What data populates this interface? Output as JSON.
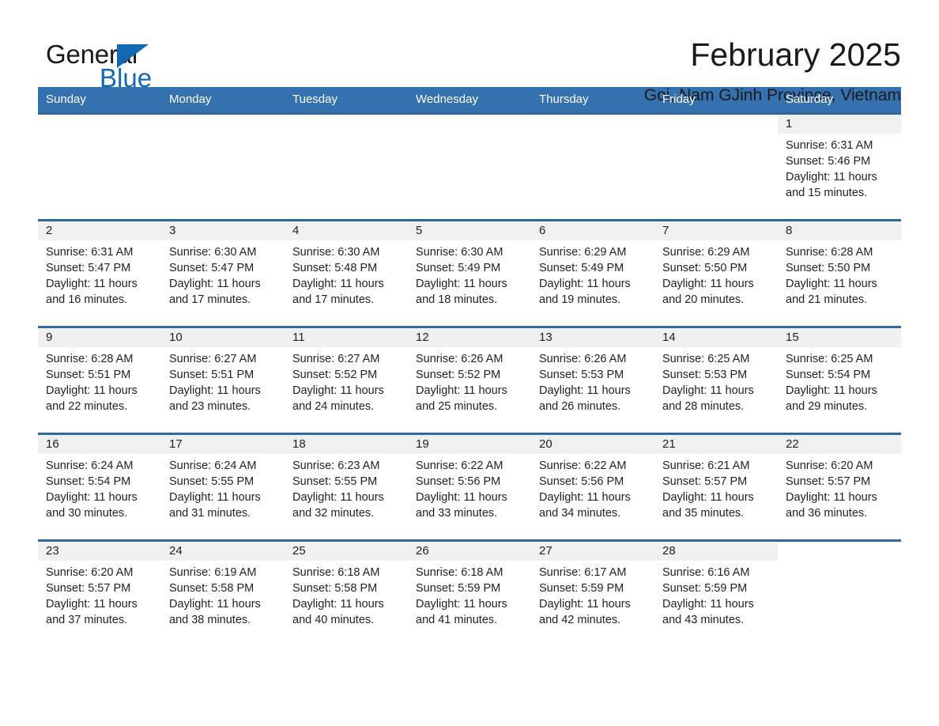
{
  "brand": {
    "name_part1": "General",
    "name_part2": "Blue",
    "logo_icon": "triangle-logo-icon"
  },
  "header": {
    "title": "February 2025",
    "subtitle": "Goi, Nam GJinh Province, Vietnam"
  },
  "colors": {
    "header_blue": "#3471ae",
    "rule_blue": "#31699c",
    "brand_blue": "#1268b3",
    "daynum_band": "#f0f0f0",
    "text": "#222222"
  },
  "weekday_headers": [
    "Sunday",
    "Monday",
    "Tuesday",
    "Wednesday",
    "Thursday",
    "Friday",
    "Saturday"
  ],
  "labels": {
    "sunrise_prefix": "Sunrise: ",
    "sunset_prefix": "Sunset: ",
    "daylight_prefix": "Daylight: "
  },
  "weeks": [
    [
      {
        "day": "",
        "blank": true
      },
      {
        "day": "",
        "blank": true
      },
      {
        "day": "",
        "blank": true
      },
      {
        "day": "",
        "blank": true
      },
      {
        "day": "",
        "blank": true
      },
      {
        "day": "",
        "blank": true
      },
      {
        "day": "1",
        "sunrise": "Sunrise: 6:31 AM",
        "sunset": "Sunset: 5:46 PM",
        "daylight": "Daylight: 11 hours and 15 minutes."
      }
    ],
    [
      {
        "day": "2",
        "sunrise": "Sunrise: 6:31 AM",
        "sunset": "Sunset: 5:47 PM",
        "daylight": "Daylight: 11 hours and 16 minutes."
      },
      {
        "day": "3",
        "sunrise": "Sunrise: 6:30 AM",
        "sunset": "Sunset: 5:47 PM",
        "daylight": "Daylight: 11 hours and 17 minutes."
      },
      {
        "day": "4",
        "sunrise": "Sunrise: 6:30 AM",
        "sunset": "Sunset: 5:48 PM",
        "daylight": "Daylight: 11 hours and 17 minutes."
      },
      {
        "day": "5",
        "sunrise": "Sunrise: 6:30 AM",
        "sunset": "Sunset: 5:49 PM",
        "daylight": "Daylight: 11 hours and 18 minutes."
      },
      {
        "day": "6",
        "sunrise": "Sunrise: 6:29 AM",
        "sunset": "Sunset: 5:49 PM",
        "daylight": "Daylight: 11 hours and 19 minutes."
      },
      {
        "day": "7",
        "sunrise": "Sunrise: 6:29 AM",
        "sunset": "Sunset: 5:50 PM",
        "daylight": "Daylight: 11 hours and 20 minutes."
      },
      {
        "day": "8",
        "sunrise": "Sunrise: 6:28 AM",
        "sunset": "Sunset: 5:50 PM",
        "daylight": "Daylight: 11 hours and 21 minutes."
      }
    ],
    [
      {
        "day": "9",
        "sunrise": "Sunrise: 6:28 AM",
        "sunset": "Sunset: 5:51 PM",
        "daylight": "Daylight: 11 hours and 22 minutes."
      },
      {
        "day": "10",
        "sunrise": "Sunrise: 6:27 AM",
        "sunset": "Sunset: 5:51 PM",
        "daylight": "Daylight: 11 hours and 23 minutes."
      },
      {
        "day": "11",
        "sunrise": "Sunrise: 6:27 AM",
        "sunset": "Sunset: 5:52 PM",
        "daylight": "Daylight: 11 hours and 24 minutes."
      },
      {
        "day": "12",
        "sunrise": "Sunrise: 6:26 AM",
        "sunset": "Sunset: 5:52 PM",
        "daylight": "Daylight: 11 hours and 25 minutes."
      },
      {
        "day": "13",
        "sunrise": "Sunrise: 6:26 AM",
        "sunset": "Sunset: 5:53 PM",
        "daylight": "Daylight: 11 hours and 26 minutes."
      },
      {
        "day": "14",
        "sunrise": "Sunrise: 6:25 AM",
        "sunset": "Sunset: 5:53 PM",
        "daylight": "Daylight: 11 hours and 28 minutes."
      },
      {
        "day": "15",
        "sunrise": "Sunrise: 6:25 AM",
        "sunset": "Sunset: 5:54 PM",
        "daylight": "Daylight: 11 hours and 29 minutes."
      }
    ],
    [
      {
        "day": "16",
        "sunrise": "Sunrise: 6:24 AM",
        "sunset": "Sunset: 5:54 PM",
        "daylight": "Daylight: 11 hours and 30 minutes."
      },
      {
        "day": "17",
        "sunrise": "Sunrise: 6:24 AM",
        "sunset": "Sunset: 5:55 PM",
        "daylight": "Daylight: 11 hours and 31 minutes."
      },
      {
        "day": "18",
        "sunrise": "Sunrise: 6:23 AM",
        "sunset": "Sunset: 5:55 PM",
        "daylight": "Daylight: 11 hours and 32 minutes."
      },
      {
        "day": "19",
        "sunrise": "Sunrise: 6:22 AM",
        "sunset": "Sunset: 5:56 PM",
        "daylight": "Daylight: 11 hours and 33 minutes."
      },
      {
        "day": "20",
        "sunrise": "Sunrise: 6:22 AM",
        "sunset": "Sunset: 5:56 PM",
        "daylight": "Daylight: 11 hours and 34 minutes."
      },
      {
        "day": "21",
        "sunrise": "Sunrise: 6:21 AM",
        "sunset": "Sunset: 5:57 PM",
        "daylight": "Daylight: 11 hours and 35 minutes."
      },
      {
        "day": "22",
        "sunrise": "Sunrise: 6:20 AM",
        "sunset": "Sunset: 5:57 PM",
        "daylight": "Daylight: 11 hours and 36 minutes."
      }
    ],
    [
      {
        "day": "23",
        "sunrise": "Sunrise: 6:20 AM",
        "sunset": "Sunset: 5:57 PM",
        "daylight": "Daylight: 11 hours and 37 minutes."
      },
      {
        "day": "24",
        "sunrise": "Sunrise: 6:19 AM",
        "sunset": "Sunset: 5:58 PM",
        "daylight": "Daylight: 11 hours and 38 minutes."
      },
      {
        "day": "25",
        "sunrise": "Sunrise: 6:18 AM",
        "sunset": "Sunset: 5:58 PM",
        "daylight": "Daylight: 11 hours and 40 minutes."
      },
      {
        "day": "26",
        "sunrise": "Sunrise: 6:18 AM",
        "sunset": "Sunset: 5:59 PM",
        "daylight": "Daylight: 11 hours and 41 minutes."
      },
      {
        "day": "27",
        "sunrise": "Sunrise: 6:17 AM",
        "sunset": "Sunset: 5:59 PM",
        "daylight": "Daylight: 11 hours and 42 minutes."
      },
      {
        "day": "28",
        "sunrise": "Sunrise: 6:16 AM",
        "sunset": "Sunset: 5:59 PM",
        "daylight": "Daylight: 11 hours and 43 minutes."
      },
      {
        "day": "",
        "blank": true
      }
    ]
  ]
}
